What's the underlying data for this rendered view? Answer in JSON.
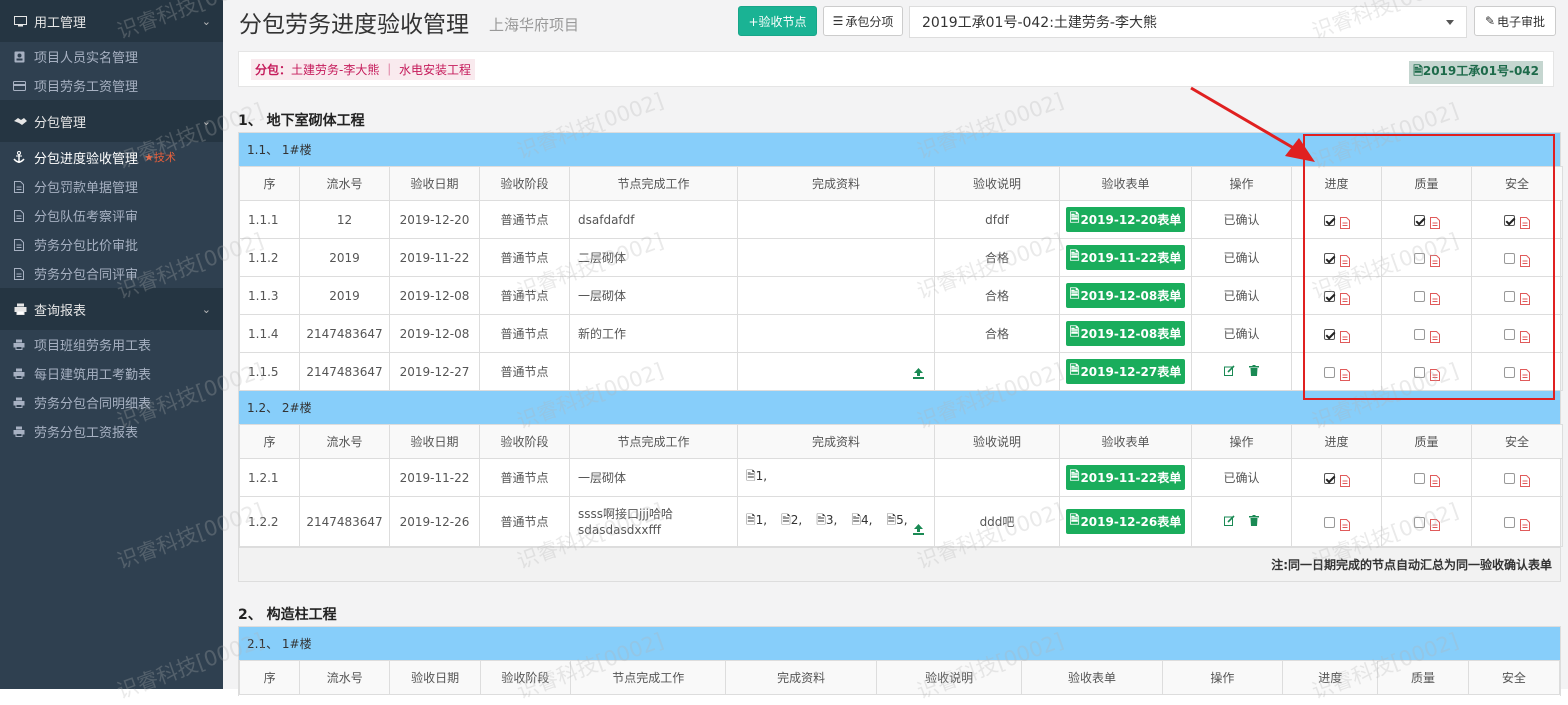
{
  "sidebar": {
    "groups": [
      {
        "label": "用工管理",
        "items": [
          {
            "label": "项目人员实名管理"
          },
          {
            "label": "项目劳务工资管理"
          }
        ]
      },
      {
        "label": "分包管理",
        "items": [
          {
            "label": "分包进度验收管理",
            "badge": "技术"
          },
          {
            "label": "分包罚款单据管理"
          },
          {
            "label": "分包队伍考察评审"
          },
          {
            "label": "劳务分包比价审批"
          },
          {
            "label": "劳务分包合同评审"
          }
        ]
      },
      {
        "label": "查询报表",
        "items": [
          {
            "label": "项目班组劳务用工表"
          },
          {
            "label": "每日建筑用工考勤表"
          },
          {
            "label": "劳务分包合同明细表"
          },
          {
            "label": "劳务分包工资报表"
          }
        ]
      }
    ]
  },
  "header": {
    "title": "分包劳务进度验收管理",
    "subtitle": "上海华府项目",
    "add_node_label": "+验收节点",
    "contract_items_label": "承包分项",
    "selected_contract": "2019工承01号-042:土建劳务-李大熊",
    "e_approval_label": "电子审批"
  },
  "info": {
    "prefix": "分包：",
    "text": "土建劳务-李大熊 ｜ 水电安装工程",
    "contract_badge": "2019工承01号-042"
  },
  "columns": [
    "序",
    "流水号",
    "验收日期",
    "验收阶段",
    "节点完成工作",
    "完成资料",
    "验收说明",
    "验收表单",
    "操作",
    "进度",
    "质量",
    "安全"
  ],
  "sections": [
    {
      "title": "1、 地下室砌体工程",
      "groups": [
        {
          "title": "1.1、 1#楼",
          "rows": [
            {
              "seq": "1.1.1",
              "serial": "12",
              "date": "2019-12-20",
              "stage": "普通节点",
              "work": "dsafdafdf",
              "docs": "",
              "note": "dfdf",
              "form": "2019-12-20表单",
              "op": "已确认",
              "progress": true,
              "quality": true,
              "safety": true
            },
            {
              "seq": "1.1.2",
              "serial": "2019",
              "date": "2019-11-22",
              "stage": "普通节点",
              "work": "二层砌体",
              "docs": "",
              "note": "合格",
              "form": "2019-11-22表单",
              "op": "已确认",
              "progress": true,
              "quality": false,
              "safety": false
            },
            {
              "seq": "1.1.3",
              "serial": "2019",
              "date": "2019-12-08",
              "stage": "普通节点",
              "work": "一层砌体",
              "docs": "",
              "note": "合格",
              "form": "2019-12-08表单",
              "op": "已确认",
              "progress": true,
              "quality": false,
              "safety": false
            },
            {
              "seq": "1.1.4",
              "serial": "2147483647",
              "date": "2019-12-08",
              "stage": "普通节点",
              "work": "新的工作",
              "docs": "",
              "note": "合格",
              "form": "2019-12-08表单",
              "op": "已确认",
              "progress": true,
              "quality": false,
              "safety": false
            },
            {
              "seq": "1.1.5",
              "serial": "2147483647",
              "date": "2019-12-27",
              "stage": "普通节点",
              "work": "",
              "docs": "",
              "note": "",
              "form": "2019-12-27表单",
              "op": "",
              "progress": false,
              "quality": false,
              "safety": false
            }
          ]
        },
        {
          "title": "1.2、 2#楼",
          "rows": [
            {
              "seq": "1.2.1",
              "serial": "",
              "date": "2019-11-22",
              "stage": "普通节点",
              "work": "一层砌体",
              "docs": "1,",
              "note": "",
              "form": "2019-11-22表单",
              "op": "已确认",
              "progress": true,
              "quality": false,
              "safety": false
            },
            {
              "seq": "1.2.2",
              "serial": "2147483647",
              "date": "2019-12-26",
              "stage": "普通节点",
              "work": "ssss啊接口jjj哈哈",
              "work2": "sdasdasdxxfff",
              "docs_list": [
                "1,",
                "2,",
                "3,",
                "4,",
                "5,"
              ],
              "note": "ddd吧",
              "form": "2019-12-26表单",
              "op": "",
              "progress": false,
              "quality": false,
              "safety": false
            }
          ]
        }
      ],
      "footnote": "注:同一日期完成的节点自动汇总为同一验收确认表单"
    },
    {
      "title": "2、 构造柱工程",
      "groups": [
        {
          "title": "2.1、 1#楼",
          "rows": []
        }
      ]
    }
  ],
  "watermark": "识睿科技[0002]",
  "colors": {
    "sidebar": "#2f4050",
    "accent": "#1ab394",
    "form_button": "#1aad5c",
    "group_header": "#87cefa",
    "highlight": "#e02020"
  }
}
